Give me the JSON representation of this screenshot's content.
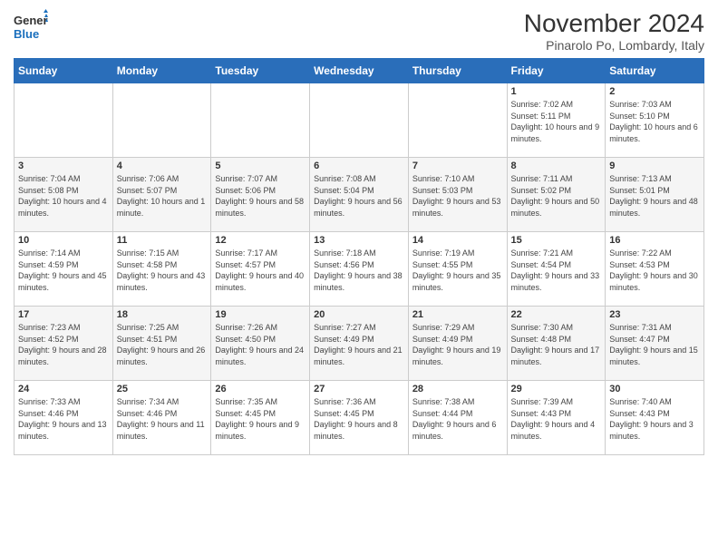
{
  "logo": {
    "line1": "General",
    "line2": "Blue"
  },
  "title": "November 2024",
  "location": "Pinarolo Po, Lombardy, Italy",
  "weekdays": [
    "Sunday",
    "Monday",
    "Tuesday",
    "Wednesday",
    "Thursday",
    "Friday",
    "Saturday"
  ],
  "weeks": [
    [
      {
        "day": "",
        "info": ""
      },
      {
        "day": "",
        "info": ""
      },
      {
        "day": "",
        "info": ""
      },
      {
        "day": "",
        "info": ""
      },
      {
        "day": "",
        "info": ""
      },
      {
        "day": "1",
        "info": "Sunrise: 7:02 AM\nSunset: 5:11 PM\nDaylight: 10 hours and 9 minutes."
      },
      {
        "day": "2",
        "info": "Sunrise: 7:03 AM\nSunset: 5:10 PM\nDaylight: 10 hours and 6 minutes."
      }
    ],
    [
      {
        "day": "3",
        "info": "Sunrise: 7:04 AM\nSunset: 5:08 PM\nDaylight: 10 hours and 4 minutes."
      },
      {
        "day": "4",
        "info": "Sunrise: 7:06 AM\nSunset: 5:07 PM\nDaylight: 10 hours and 1 minute."
      },
      {
        "day": "5",
        "info": "Sunrise: 7:07 AM\nSunset: 5:06 PM\nDaylight: 9 hours and 58 minutes."
      },
      {
        "day": "6",
        "info": "Sunrise: 7:08 AM\nSunset: 5:04 PM\nDaylight: 9 hours and 56 minutes."
      },
      {
        "day": "7",
        "info": "Sunrise: 7:10 AM\nSunset: 5:03 PM\nDaylight: 9 hours and 53 minutes."
      },
      {
        "day": "8",
        "info": "Sunrise: 7:11 AM\nSunset: 5:02 PM\nDaylight: 9 hours and 50 minutes."
      },
      {
        "day": "9",
        "info": "Sunrise: 7:13 AM\nSunset: 5:01 PM\nDaylight: 9 hours and 48 minutes."
      }
    ],
    [
      {
        "day": "10",
        "info": "Sunrise: 7:14 AM\nSunset: 4:59 PM\nDaylight: 9 hours and 45 minutes."
      },
      {
        "day": "11",
        "info": "Sunrise: 7:15 AM\nSunset: 4:58 PM\nDaylight: 9 hours and 43 minutes."
      },
      {
        "day": "12",
        "info": "Sunrise: 7:17 AM\nSunset: 4:57 PM\nDaylight: 9 hours and 40 minutes."
      },
      {
        "day": "13",
        "info": "Sunrise: 7:18 AM\nSunset: 4:56 PM\nDaylight: 9 hours and 38 minutes."
      },
      {
        "day": "14",
        "info": "Sunrise: 7:19 AM\nSunset: 4:55 PM\nDaylight: 9 hours and 35 minutes."
      },
      {
        "day": "15",
        "info": "Sunrise: 7:21 AM\nSunset: 4:54 PM\nDaylight: 9 hours and 33 minutes."
      },
      {
        "day": "16",
        "info": "Sunrise: 7:22 AM\nSunset: 4:53 PM\nDaylight: 9 hours and 30 minutes."
      }
    ],
    [
      {
        "day": "17",
        "info": "Sunrise: 7:23 AM\nSunset: 4:52 PM\nDaylight: 9 hours and 28 minutes."
      },
      {
        "day": "18",
        "info": "Sunrise: 7:25 AM\nSunset: 4:51 PM\nDaylight: 9 hours and 26 minutes."
      },
      {
        "day": "19",
        "info": "Sunrise: 7:26 AM\nSunset: 4:50 PM\nDaylight: 9 hours and 24 minutes."
      },
      {
        "day": "20",
        "info": "Sunrise: 7:27 AM\nSunset: 4:49 PM\nDaylight: 9 hours and 21 minutes."
      },
      {
        "day": "21",
        "info": "Sunrise: 7:29 AM\nSunset: 4:49 PM\nDaylight: 9 hours and 19 minutes."
      },
      {
        "day": "22",
        "info": "Sunrise: 7:30 AM\nSunset: 4:48 PM\nDaylight: 9 hours and 17 minutes."
      },
      {
        "day": "23",
        "info": "Sunrise: 7:31 AM\nSunset: 4:47 PM\nDaylight: 9 hours and 15 minutes."
      }
    ],
    [
      {
        "day": "24",
        "info": "Sunrise: 7:33 AM\nSunset: 4:46 PM\nDaylight: 9 hours and 13 minutes."
      },
      {
        "day": "25",
        "info": "Sunrise: 7:34 AM\nSunset: 4:46 PM\nDaylight: 9 hours and 11 minutes."
      },
      {
        "day": "26",
        "info": "Sunrise: 7:35 AM\nSunset: 4:45 PM\nDaylight: 9 hours and 9 minutes."
      },
      {
        "day": "27",
        "info": "Sunrise: 7:36 AM\nSunset: 4:45 PM\nDaylight: 9 hours and 8 minutes."
      },
      {
        "day": "28",
        "info": "Sunrise: 7:38 AM\nSunset: 4:44 PM\nDaylight: 9 hours and 6 minutes."
      },
      {
        "day": "29",
        "info": "Sunrise: 7:39 AM\nSunset: 4:43 PM\nDaylight: 9 hours and 4 minutes."
      },
      {
        "day": "30",
        "info": "Sunrise: 7:40 AM\nSunset: 4:43 PM\nDaylight: 9 hours and 3 minutes."
      }
    ]
  ]
}
